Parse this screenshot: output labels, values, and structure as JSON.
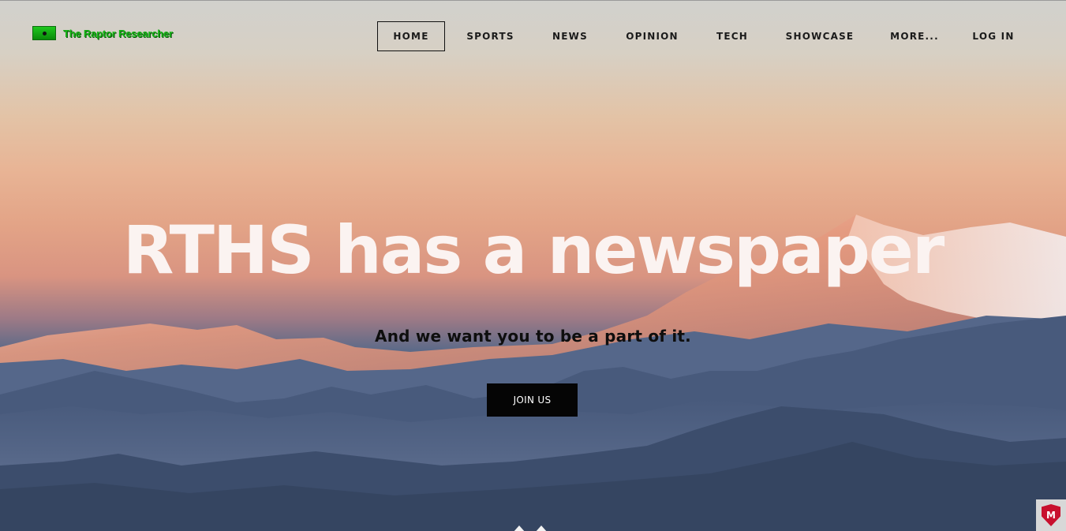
{
  "site": {
    "logo_text": "The Raptor Researcher"
  },
  "nav": {
    "items": [
      {
        "label": "HOME",
        "active": true
      },
      {
        "label": "SPORTS",
        "active": false
      },
      {
        "label": "NEWS",
        "active": false
      },
      {
        "label": "OPINION",
        "active": false
      },
      {
        "label": "TECH",
        "active": false
      },
      {
        "label": "SHOWCASE",
        "active": false
      },
      {
        "label": "MORE...",
        "active": false
      },
      {
        "label": "LOG IN",
        "active": false
      }
    ]
  },
  "hero": {
    "headline": "RTHS has a newspaper",
    "subheadline": "And we want you to be a part of it.",
    "cta_label": "JOIN US"
  },
  "security_badge": {
    "letter": "M"
  },
  "icons": {
    "logo": "raptor-logo-icon",
    "scroll": "chevron-down-icon",
    "badge": "security-shield-icon"
  },
  "colors": {
    "logo_green": "#16b516",
    "nav_text": "#1b1b1b",
    "headline": "#fbf3f1",
    "cta_bg": "#050505",
    "badge_red": "#c8102e"
  }
}
